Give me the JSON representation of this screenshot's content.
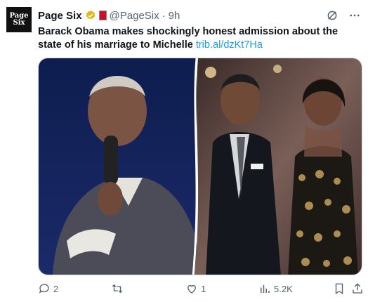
{
  "tweet": {
    "avatar_line1": "Page",
    "avatar_line2": "Six",
    "author_name": "Page Six",
    "handle": "@PageSix",
    "separator": "·",
    "time": "9h",
    "text": "Barack Obama makes shockingly honest admission about the state of his marriage to Michelle",
    "link": "trib.al/dzKt7Ha"
  },
  "actions": {
    "replies": "2",
    "retweets": "",
    "likes": "1",
    "views": "5.2K"
  },
  "colors": {
    "link": "#1d9bf0",
    "verified_gold": "#e2b719",
    "muted": "#536471"
  },
  "icons": [
    "grok-icon",
    "more-icon",
    "reply-icon",
    "retweet-icon",
    "like-icon",
    "views-icon",
    "bookmark-icon",
    "share-icon"
  ]
}
